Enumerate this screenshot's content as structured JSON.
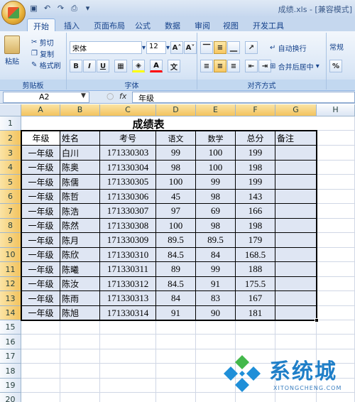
{
  "window": {
    "title": "成绩.xls - [兼容模式]"
  },
  "tabs": [
    "开始",
    "插入",
    "页面布局",
    "公式",
    "数据",
    "审阅",
    "视图",
    "开发工具"
  ],
  "ribbon": {
    "clipboard": {
      "paste": "粘贴",
      "cut": "剪切",
      "copy": "复制",
      "format_painter": "格式刷",
      "label": "剪贴板"
    },
    "font": {
      "name": "宋体",
      "size": "12",
      "label": "字体",
      "bold": "B",
      "italic": "I",
      "underline": "U"
    },
    "alignment": {
      "wrap": "自动换行",
      "merge": "合并后居中",
      "label": "对齐方式"
    },
    "number": {
      "format": "常规"
    }
  },
  "formula_bar": {
    "name_box": "A2",
    "fx": "fx",
    "content": "年级"
  },
  "columns": [
    "A",
    "B",
    "C",
    "D",
    "E",
    "F",
    "G",
    "H"
  ],
  "rows": [
    "1",
    "2",
    "3",
    "4",
    "5",
    "6",
    "7",
    "8",
    "9",
    "10",
    "11",
    "12",
    "13",
    "14",
    "15",
    "16",
    "17",
    "18",
    "19",
    "20"
  ],
  "sheet": {
    "title": "成绩表",
    "headers": [
      "年级",
      "姓名",
      "考号",
      "语文",
      "数学",
      "总分",
      "备注"
    ],
    "data": [
      [
        "一年级",
        "白川",
        "171330303",
        "99",
        "100",
        "199",
        ""
      ],
      [
        "一年级",
        "陈奥",
        "171330304",
        "98",
        "100",
        "198",
        ""
      ],
      [
        "一年级",
        "陈儒",
        "171330305",
        "100",
        "99",
        "199",
        ""
      ],
      [
        "一年级",
        "陈哲",
        "171330306",
        "45",
        "98",
        "143",
        ""
      ],
      [
        "一年级",
        "陈浩",
        "171330307",
        "97",
        "69",
        "166",
        ""
      ],
      [
        "一年级",
        "陈然",
        "171330308",
        "100",
        "98",
        "198",
        ""
      ],
      [
        "一年级",
        "陈月",
        "171330309",
        "89.5",
        "89.5",
        "179",
        ""
      ],
      [
        "一年级",
        "陈欣",
        "171330310",
        "84.5",
        "84",
        "168.5",
        ""
      ],
      [
        "一年级",
        "陈曦",
        "171330311",
        "89",
        "99",
        "188",
        ""
      ],
      [
        "一年级",
        "陈汝",
        "171330312",
        "84.5",
        "91",
        "175.5",
        ""
      ],
      [
        "一年级",
        "陈雨",
        "171330313",
        "84",
        "83",
        "167",
        ""
      ],
      [
        "一年级",
        "陈旭",
        "171330314",
        "91",
        "90",
        "181",
        ""
      ]
    ]
  },
  "watermark": {
    "text": "系统城",
    "sub": "XITONGCHENG.COM"
  }
}
